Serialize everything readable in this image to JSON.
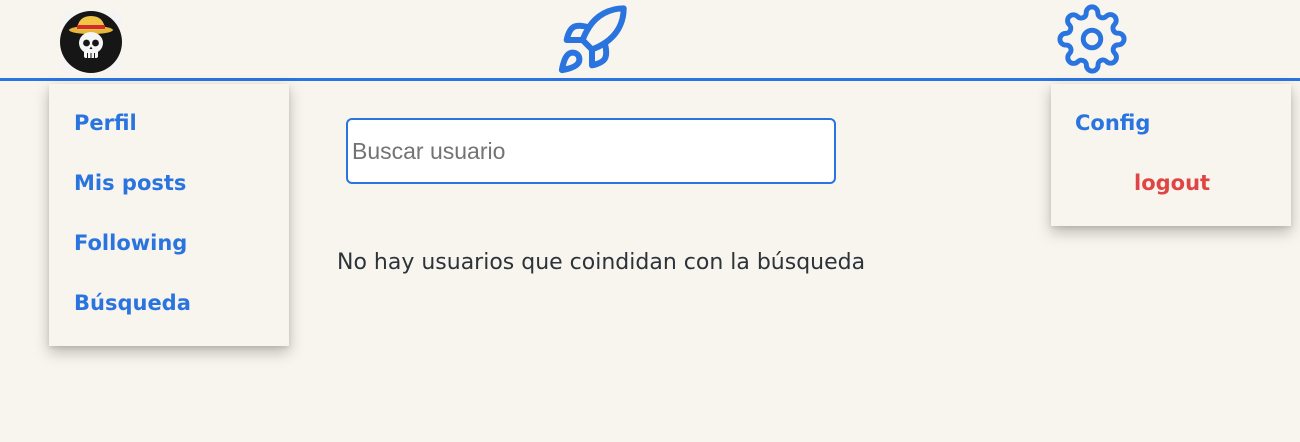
{
  "header": {
    "avatar_icon": "straw-hat-jolly-roger-avatar",
    "center_icon": "rocket-icon",
    "settings_icon": "gear-icon"
  },
  "left_menu": {
    "items": [
      {
        "label": "Perfil"
      },
      {
        "label": "Mis posts"
      },
      {
        "label": "Following"
      },
      {
        "label": "Búsqueda"
      }
    ]
  },
  "right_menu": {
    "items": [
      {
        "label": "Config"
      },
      {
        "label": "logout"
      }
    ]
  },
  "search": {
    "placeholder": "Buscar usuario",
    "value": ""
  },
  "results": {
    "empty_message": "No hay usuarios que coindidan con la búsqueda"
  },
  "colors": {
    "accent": "#2a74e0",
    "danger": "#e04444",
    "background": "#f8f5ee",
    "text": "#2d333a"
  }
}
